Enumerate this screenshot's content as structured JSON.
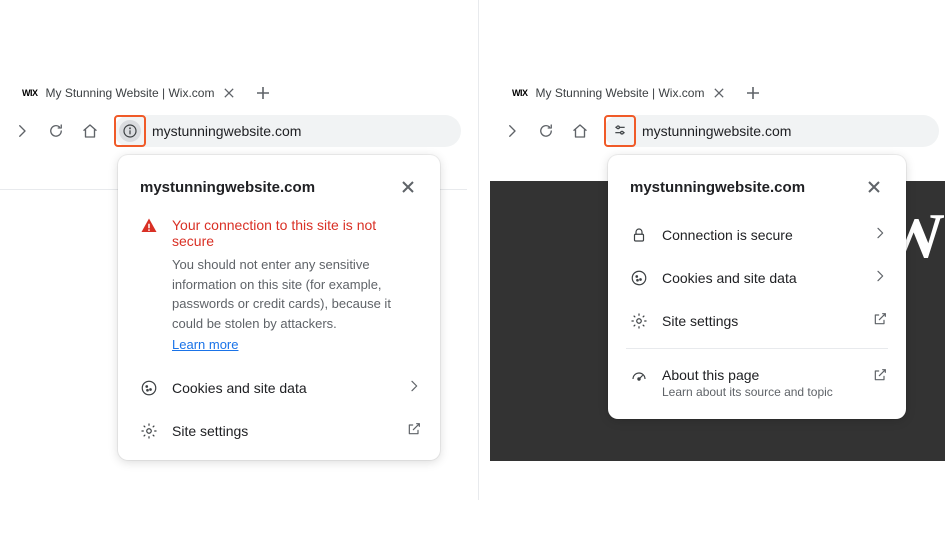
{
  "highlight_color": "#f05a28",
  "left": {
    "tab": {
      "favicon_text": "WIX",
      "title": "My Stunning Website | Wix.com"
    },
    "omnibox_text": "mystunningwebsite.com",
    "popover": {
      "title": "mystunningwebsite.com",
      "warning_heading": "Your connection to this site is not secure",
      "warning_body": "You should not enter any sensitive information on this site (for example, passwords or credit cards), because it could be stolen by attackers.",
      "learn_more": "Learn more",
      "cookies": "Cookies and site data",
      "site_settings": "Site settings"
    }
  },
  "right": {
    "tab": {
      "favicon_text": "WIX",
      "title": "My Stunning Website | Wix.com"
    },
    "omnibox_text": "mystunningwebsite.com",
    "content_letter": "W",
    "popover": {
      "title": "mystunningwebsite.com",
      "connection_secure": "Connection is secure",
      "cookies": "Cookies and site data",
      "site_settings": "Site settings",
      "about_page": "About this page",
      "about_sub": "Learn about its source and topic"
    }
  }
}
